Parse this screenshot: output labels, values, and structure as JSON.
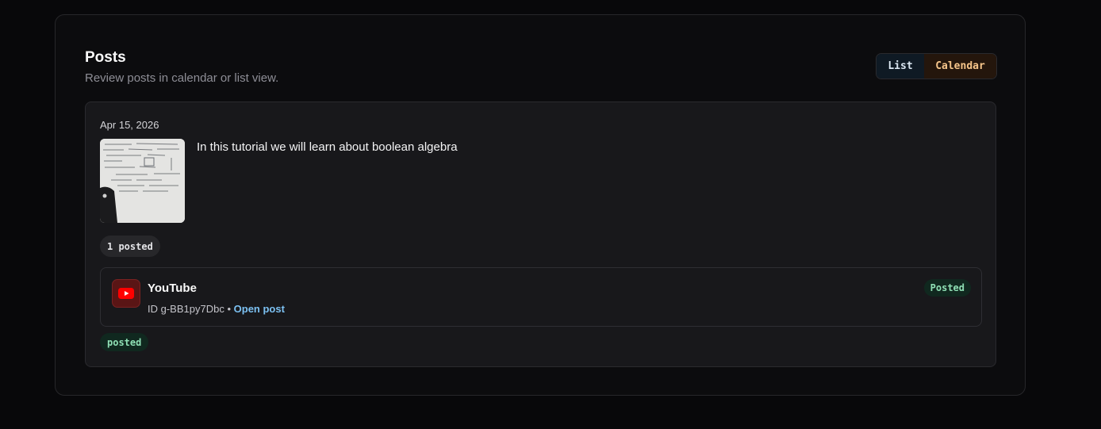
{
  "header": {
    "title": "Posts",
    "subtitle": "Review posts in calendar or list view."
  },
  "view_toggle": {
    "options": [
      "List",
      "Calendar"
    ]
  },
  "post": {
    "date": "Apr 15, 2026",
    "text": "In this tutorial we will learn about boolean algebra",
    "thumbnail_icon": "video-thumbnail-whiteboard",
    "count_label": "1 posted",
    "platform": {
      "icon": "youtube-icon",
      "name": "YouTube",
      "id_text": "ID g-BB1py7Dbc",
      "separator": "•",
      "link_label": "Open post",
      "status": "Posted"
    },
    "state_tag": "posted"
  },
  "colors": {
    "background": "#08080a",
    "panel": "#0c0c0e",
    "card": "#18181b",
    "accent_blue": "#7cc1f2",
    "accent_orange": "#f6c58a",
    "success": "#8fe0b5",
    "youtube_red": "#ff0000"
  }
}
